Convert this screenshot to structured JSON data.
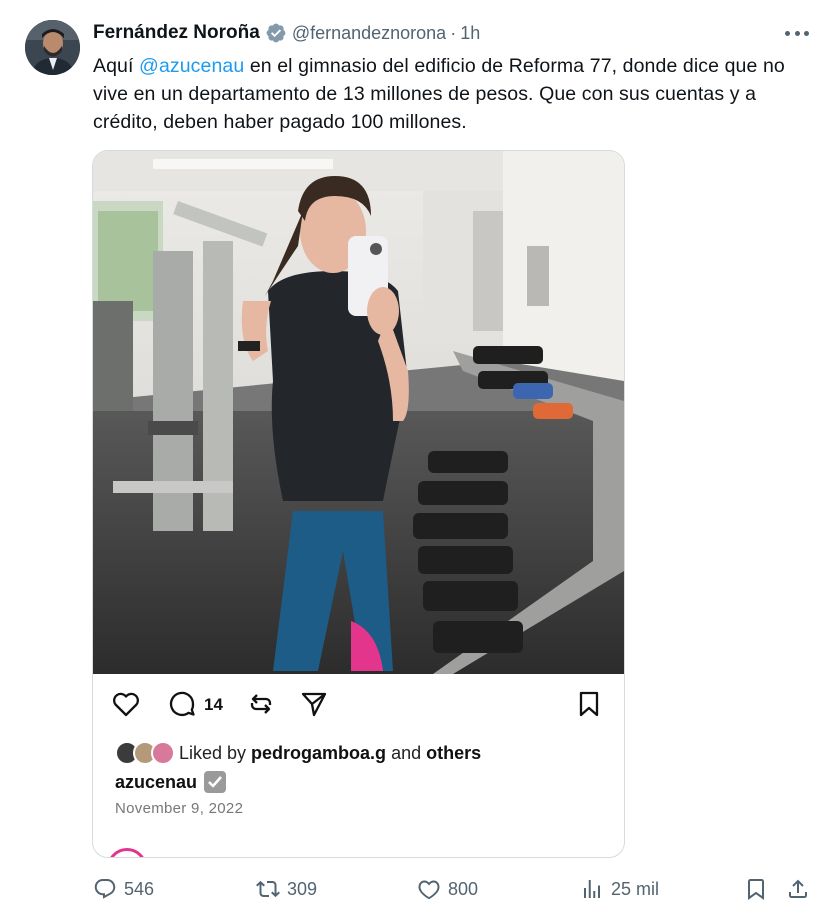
{
  "author": {
    "display_name": "Fernández Noroña",
    "handle": "@fernandeznorona",
    "separator": "·",
    "time": "1h"
  },
  "tweet": {
    "text_part1": "Aquí ",
    "mention": "@azucenau",
    "text_part2": " en el gimnasio del edificio de Reforma 77, donde dice que no vive en un departamento de 13 millones de pesos. Que con sus cuentas y a crédito, deben haber pagado 100 millones."
  },
  "embedded_post": {
    "comment_count": "14",
    "liked_prefix": "Liked by ",
    "liked_user": "pedrogamboa.g",
    "liked_and": " and ",
    "liked_others": "others",
    "username": "azucenau",
    "date": "November 9, 2022"
  },
  "footer": {
    "replies": "546",
    "reposts": "309",
    "likes": "800",
    "views": "25 mil"
  },
  "colors": {
    "accent": "#1d9bf0",
    "secondary_text": "#536471",
    "verified": "#829aab"
  }
}
